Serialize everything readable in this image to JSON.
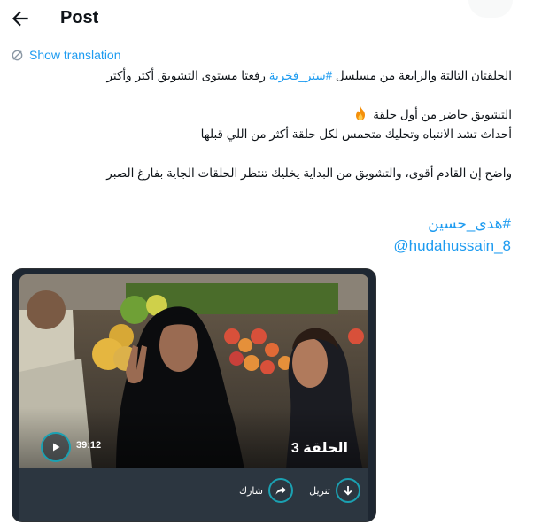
{
  "header": {
    "title": "Post",
    "back_icon": "arrow-left-icon"
  },
  "translate": {
    "label": "Show translation",
    "icon": "translate-icon"
  },
  "post": {
    "line1_pre": "الحلقتان الثالثة والرابعة  من مسلسل ",
    "line1_tag": "#ستر_فخرية",
    "line1_post": " رفعتا مستوى التشويق أكثر وأكثر",
    "line2": "التشويق حاضر من أول حلقة",
    "line2_emoji": "fire-emoji",
    "line3": "أحداث تشد الانتباه وتخليك متحمس لكل حلقة أكثر من اللي قبلها",
    "line4": "واضح إن القادم أقوى، والتشويق من البداية يخليك تنتظر الحلقات الجاية بفارغ الصبر",
    "hashtag": "#هدى_حسين",
    "handle": "@hudahussain_8"
  },
  "video_card": {
    "episode_title": "الحلقة 3",
    "duration": "39:12",
    "download_label": "تنزيل",
    "share_label": "شارك",
    "accent_color": "#1ba1b2"
  }
}
